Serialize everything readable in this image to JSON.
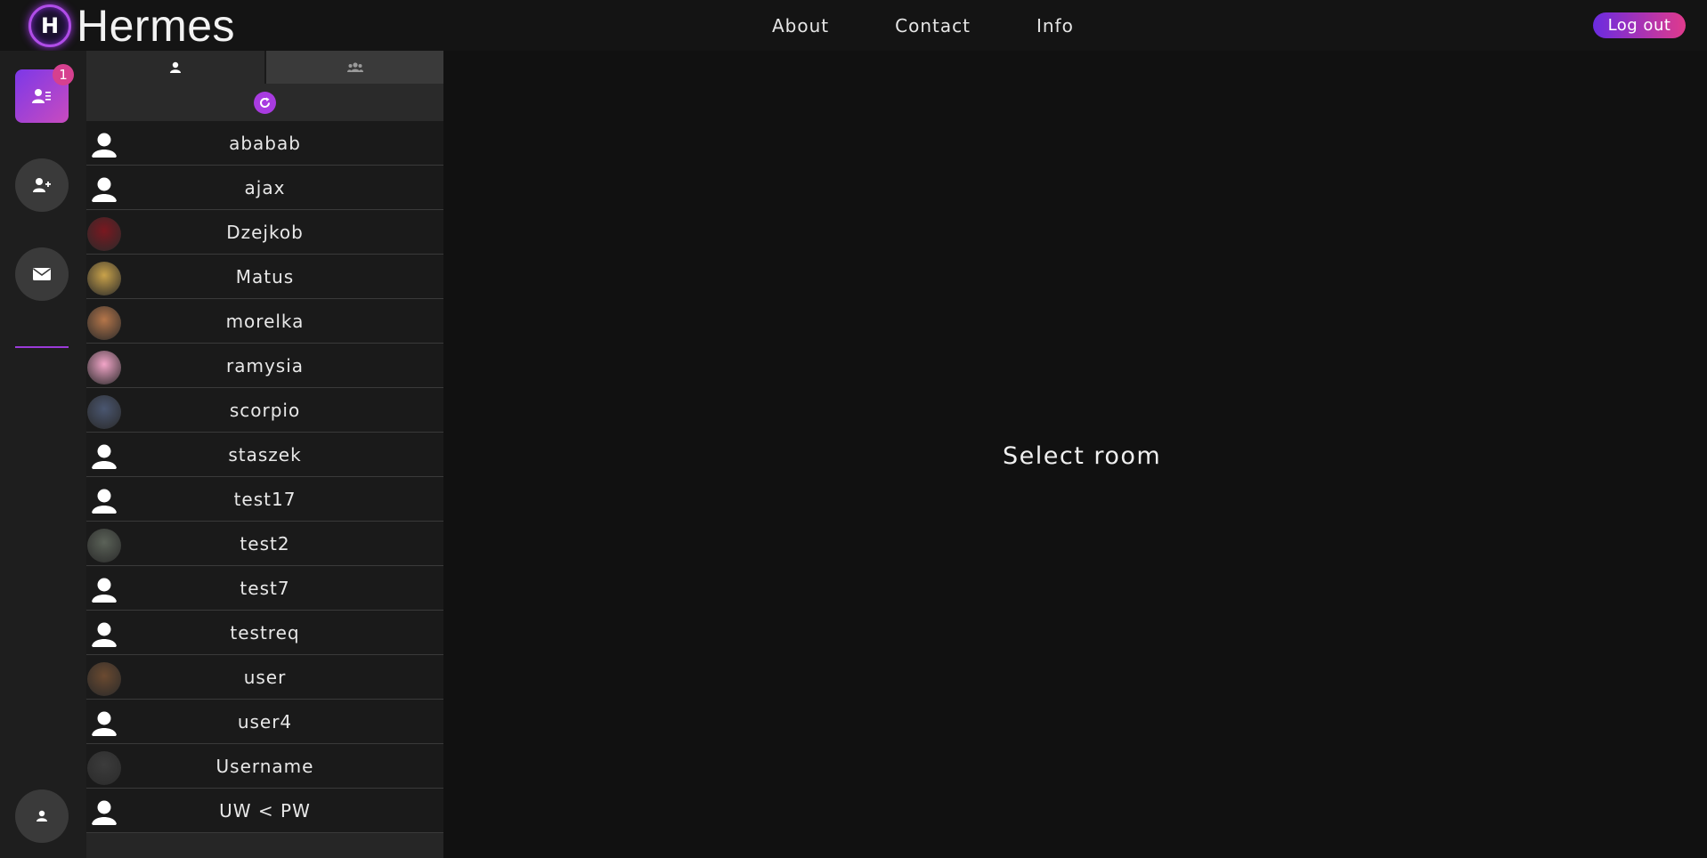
{
  "app": {
    "title": "Hermes",
    "logo_glyph": "H"
  },
  "nav": {
    "items": [
      "About",
      "Contact",
      "Info"
    ]
  },
  "header": {
    "logout_label": "Log out"
  },
  "rail": {
    "friends_badge": "1",
    "buttons": [
      "friends-list-icon",
      "add-friend-icon",
      "envelope-icon",
      "profile-icon"
    ]
  },
  "panel": {
    "tabs": [
      "user-icon",
      "users-group-icon"
    ],
    "contacts": [
      {
        "name": "ababab",
        "avatar": "default",
        "color": ""
      },
      {
        "name": "ajax",
        "avatar": "default",
        "color": ""
      },
      {
        "name": "Dzejkob",
        "avatar": "photo",
        "color": "#7a1820"
      },
      {
        "name": "Matus",
        "avatar": "photo",
        "color": "#c9a24a"
      },
      {
        "name": "morelka",
        "avatar": "photo",
        "color": "#b5764a"
      },
      {
        "name": "ramysia",
        "avatar": "photo",
        "color": "#f2a5c8"
      },
      {
        "name": "scorpio",
        "avatar": "photo",
        "color": "#4a5670"
      },
      {
        "name": "staszek",
        "avatar": "default",
        "color": ""
      },
      {
        "name": "test17",
        "avatar": "default",
        "color": ""
      },
      {
        "name": "test2",
        "avatar": "photo",
        "color": "#5b6258"
      },
      {
        "name": "test7",
        "avatar": "default",
        "color": ""
      },
      {
        "name": "testreq",
        "avatar": "default",
        "color": ""
      },
      {
        "name": "user",
        "avatar": "photo",
        "color": "#6b4a30"
      },
      {
        "name": "user4",
        "avatar": "default",
        "color": ""
      },
      {
        "name": "Username",
        "avatar": "photo",
        "color": "#3c3c3c"
      },
      {
        "name": "UW < PW",
        "avatar": "default",
        "color": ""
      }
    ]
  },
  "main": {
    "placeholder": "Select room"
  },
  "colors": {
    "accent": "#a83be0",
    "logout_start": "#6a2be0",
    "logout_end": "#e03a8c"
  }
}
